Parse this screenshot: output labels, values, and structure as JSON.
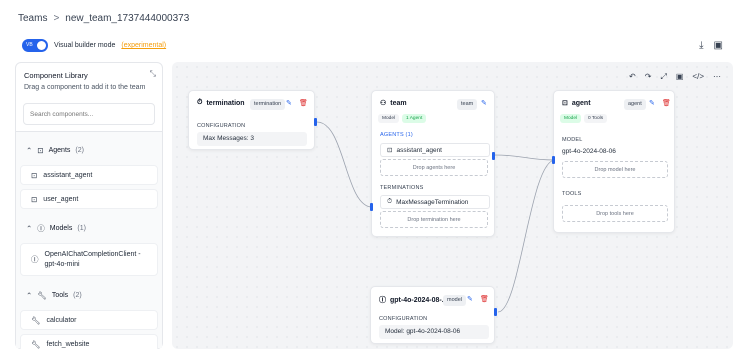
{
  "breadcrumb": {
    "root": "Teams",
    "sep": ">",
    "current": "new_team_1737444000373"
  },
  "mode": {
    "toggle_label": "VB",
    "label": "Visual builder mode",
    "experimental": "(experimental)"
  },
  "library": {
    "title": "Component Library",
    "subtitle": "Drag a component to add it to the team",
    "search_placeholder": "Search components...",
    "sections": [
      {
        "title": "Agents",
        "count": "(2)",
        "items": [
          "assistant_agent",
          "user_agent"
        ]
      },
      {
        "title": "Models",
        "count": "(1)",
        "items": [
          "OpenAIChatCompletionClient - gpt-4o-mini"
        ]
      },
      {
        "title": "Tools",
        "count": "(2)",
        "items": [
          "calculator",
          "fetch_website"
        ]
      }
    ]
  },
  "nodes": {
    "termination": {
      "title": "termination",
      "tag": "termination",
      "config_label": "CONFIGURATION",
      "config_value": "Max Messages: 3"
    },
    "team": {
      "title": "team",
      "tag": "team",
      "chip_model": "Model",
      "chip_agents": "1 Agent",
      "agents_label": "AGENTS (1)",
      "agent_name": "assistant_agent",
      "drop_agents": "Drop agents here",
      "terminations_label": "TERMINATIONS",
      "termination_name": "MaxMessageTermination",
      "drop_termination": "Drop termination here"
    },
    "agent": {
      "title": "agent",
      "tag": "agent",
      "chip_model": "Model",
      "chip_tools": "0 Tools",
      "model_label": "MODEL",
      "model_value": "gpt-4o-2024-08-06",
      "drop_model": "Drop model here",
      "tools_label": "TOOLS",
      "drop_tools": "Drop tools here"
    },
    "model": {
      "title": "gpt-4o-2024-08-...",
      "tag": "model",
      "config_label": "CONFIGURATION",
      "config_value": "Model: gpt-4o-2024-08-06"
    }
  },
  "colors": {
    "accent": "#2563eb",
    "danger": "#dc2626",
    "experimental": "#f59e0b",
    "success": "#16a34a"
  }
}
